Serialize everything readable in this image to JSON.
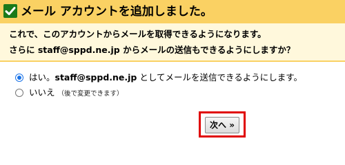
{
  "header": {
    "title": "メール アカウントを追加しました。",
    "icon": "check-icon",
    "background_color": "#fad163"
  },
  "description": {
    "line1": "これで、このアカウントからメールを取得できるようになります。",
    "line2_prefix": "さらに ",
    "line2_email": "staff@sppd.ne.jp",
    "line2_suffix": " からメールの送信もできるようにしますか？"
  },
  "options": [
    {
      "prefix": "はい。",
      "email": "staff@sppd.ne.jp",
      "suffix": " としてメールを送信できるようにします。",
      "selected": true
    },
    {
      "label": "いいえ",
      "note": "（後で変更できます）",
      "selected": false
    }
  ],
  "next_button": {
    "label": "次へ »",
    "highlight_color": "#e00000"
  }
}
